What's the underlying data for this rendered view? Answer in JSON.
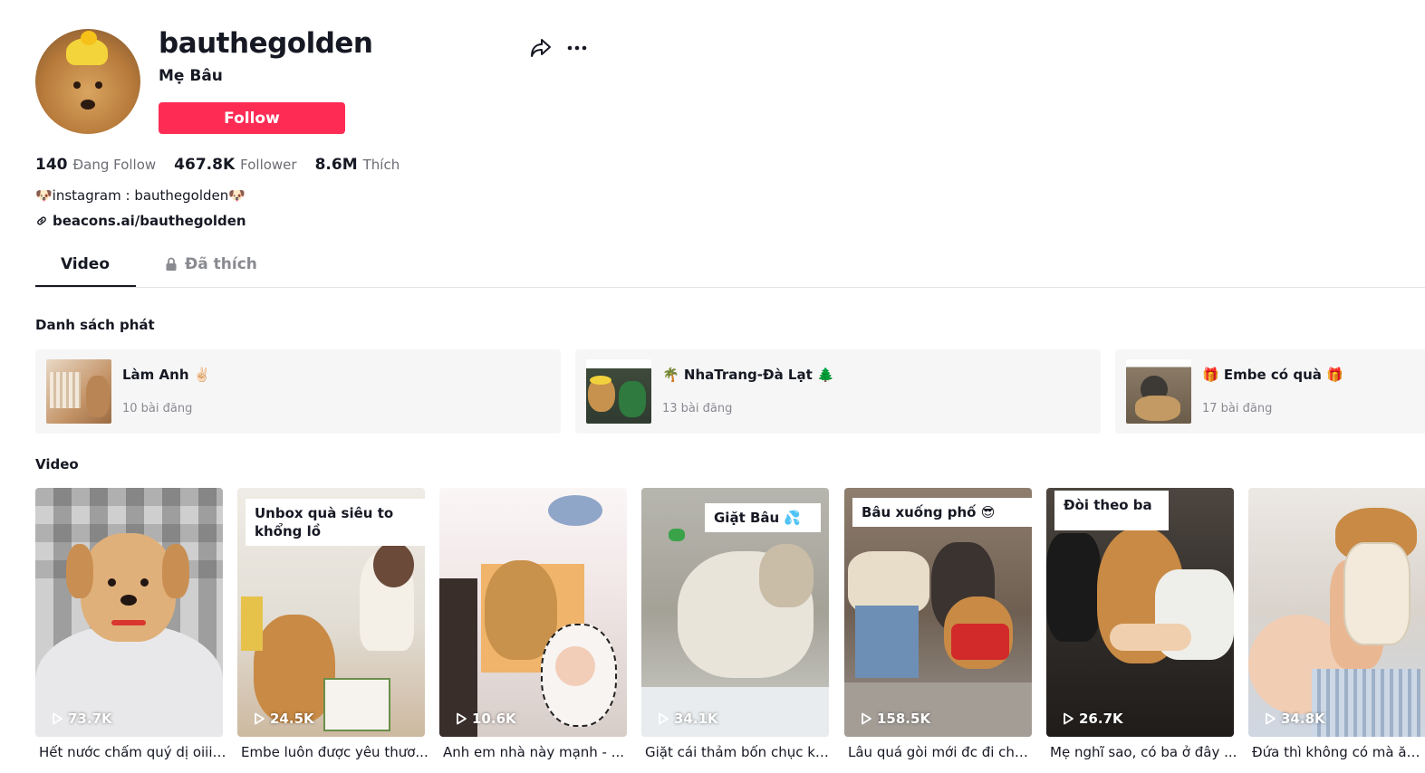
{
  "profile": {
    "username": "bauthegolden",
    "nickname": "Mẹ Bâu",
    "follow_label": "Follow",
    "stats": {
      "following_count": "140",
      "following_label": "Đang Follow",
      "followers_count": "467.8K",
      "followers_label": "Follower",
      "likes_count": "8.6M",
      "likes_label": "Thích"
    },
    "bio": "🐶instagram : bauthegolden🐶",
    "link": "beacons.ai/bauthegolden"
  },
  "tabs": {
    "video": "Video",
    "liked": "Đã thích"
  },
  "playlists": {
    "title": "Danh sách phát",
    "items": [
      {
        "title": "Làm Anh ✌🏻",
        "count": "10 bài đăng"
      },
      {
        "title": "🌴 NhaTrang-Đà Lạt 🌲",
        "count": "13 bài đăng"
      },
      {
        "title": "🎁 Embe có quà 🎁",
        "count": "17 bài đăng"
      }
    ]
  },
  "videos": {
    "title": "Video",
    "items": [
      {
        "views": "73.7K",
        "caption": "Hết nước chấm quý dị oiiii...",
        "overlay": ""
      },
      {
        "views": "24.5K",
        "caption": "Embe luôn được yêu thươ...",
        "overlay": "Unbox quà siêu to khổng lồ"
      },
      {
        "views": "10.6K",
        "caption": "Anh em nhà này mạnh - ...",
        "overlay": ""
      },
      {
        "views": "34.1K",
        "caption": "Giặt cái thảm bốn chục kí ...",
        "overlay": "Giặt Bâu 💦"
      },
      {
        "views": "158.5K",
        "caption": "Lâu quá gòi mới đc đi cho...",
        "overlay": "Bâu xuống phố 😎"
      },
      {
        "views": "26.7K",
        "caption": "Mẹ nghĩ sao, có ba ở đây ...",
        "overlay": "Đòi theo ba"
      },
      {
        "views": "34.8K",
        "caption": "Đứa thì không có mà ăn , ...",
        "overlay": ""
      }
    ]
  },
  "colors": {
    "accent": "#fe2c55",
    "text": "#161823",
    "muted": "#8a8b91"
  },
  "icons": {
    "share": "share-arrow-icon",
    "more": "more-dots-icon",
    "link": "link-icon",
    "lock": "lock-icon",
    "play": "play-icon"
  }
}
